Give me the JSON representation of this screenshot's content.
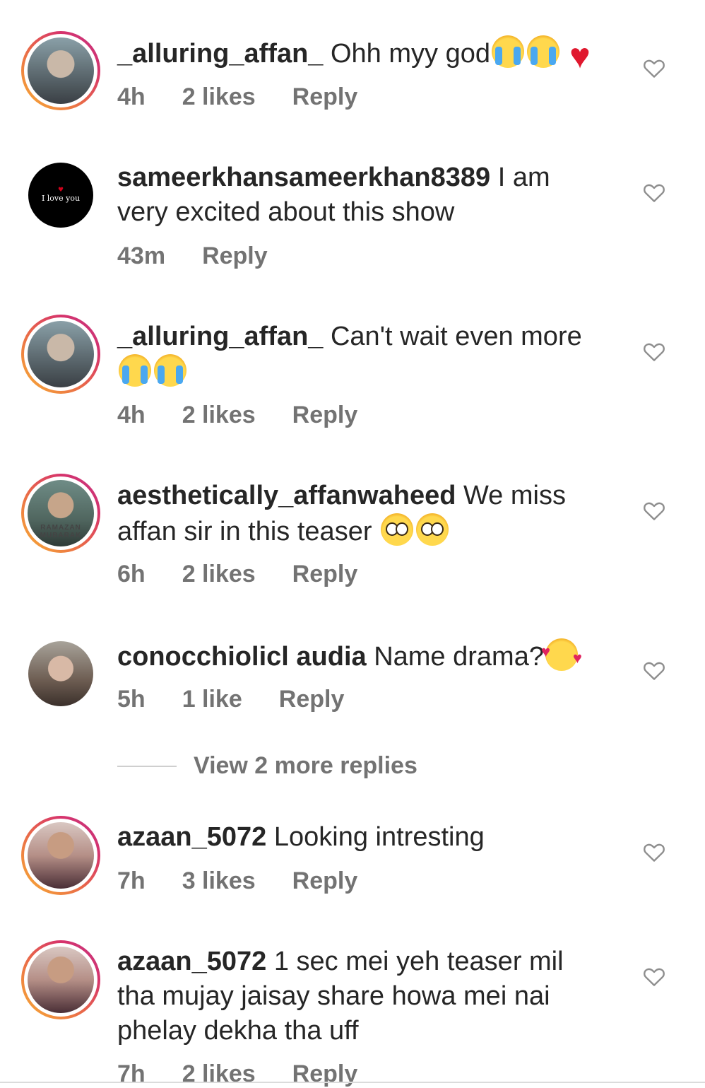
{
  "comments": [
    {
      "username": "_alluring_affan_",
      "text": "Ohh myy god",
      "emojis": [
        "loudly-crying-face",
        "loudly-crying-face",
        "red-heart"
      ],
      "time": "4h",
      "likes": "2 likes",
      "reply": "Reply",
      "avatar": "portrait-man-light-shirt",
      "story_ring": true
    },
    {
      "username": "sameerkhansameerkhan8389",
      "text": "I am very excited about this show",
      "emojis": [],
      "time": "43m",
      "likes": "",
      "reply": "Reply",
      "avatar": "black-background-love-text",
      "avatar_text": "I love you",
      "story_ring": false
    },
    {
      "username": "_alluring_affan_",
      "text": "Can't wait even more",
      "emojis": [
        "loudly-crying-face",
        "loudly-crying-face"
      ],
      "time": "4h",
      "likes": "2 likes",
      "reply": "Reply",
      "avatar": "portrait-man-light-shirt",
      "story_ring": true
    },
    {
      "username": "aesthetically_affanwaheed",
      "text": "We miss affan sir in this teaser",
      "emojis": [
        "pleading-face",
        "pleading-face"
      ],
      "time": "6h",
      "likes": "2 likes",
      "reply": "Reply",
      "avatar": "portrait-man-ramazan-frame",
      "avatar_text": "RAMAZAN MUBARAK",
      "story_ring": true
    },
    {
      "username": "conocchiolicl audia",
      "text": "Name drama?",
      "emojis": [
        "smiling-face-with-hearts"
      ],
      "time": "5h",
      "likes": "1 like",
      "reply": "Reply",
      "avatar": "portrait-woman",
      "story_ring": false
    },
    {
      "username": "azaan_5072",
      "text": "Looking intresting",
      "emojis": [],
      "time": "7h",
      "likes": "3 likes",
      "reply": "Reply",
      "avatar": "portrait-man-dark-jacket",
      "story_ring": true
    },
    {
      "username": "azaan_5072",
      "text": "1 sec mei yeh teaser mil tha mujay jaisay share howa mei nai phelay dekha tha uff",
      "emojis": [],
      "time": "7h",
      "likes": "2 likes",
      "reply": "Reply",
      "avatar": "portrait-man-dark-jacket",
      "story_ring": true
    }
  ],
  "view_more_replies": "View 2 more replies",
  "colors": {
    "text": "#262626",
    "meta": "#737373",
    "story_ring_start": "#f9b233",
    "story_ring_end": "#c13584"
  }
}
